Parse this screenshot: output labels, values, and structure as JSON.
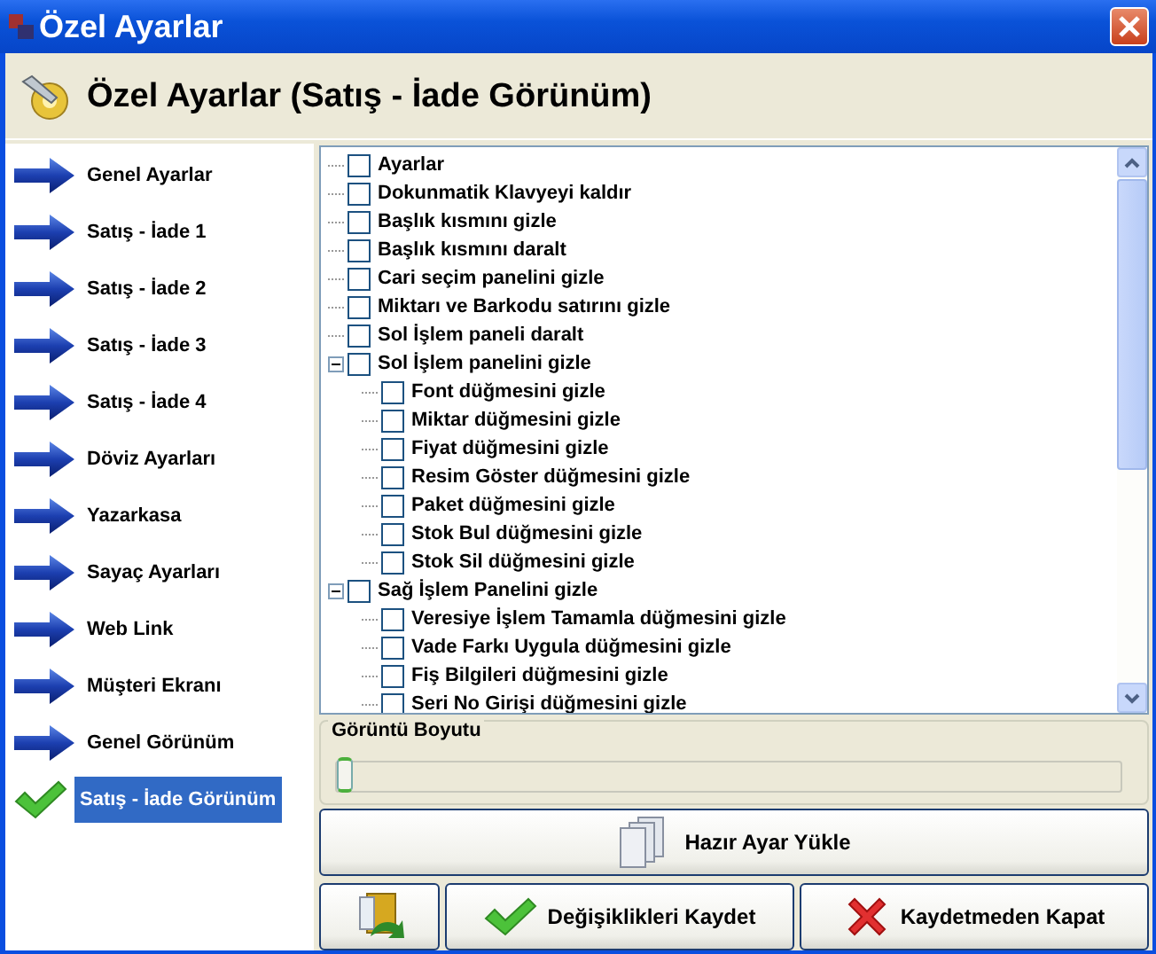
{
  "window": {
    "title": "Özel Ayarlar"
  },
  "header": {
    "title": "Özel Ayarlar (Satış - İade Görünüm)"
  },
  "sidebar": {
    "items": [
      {
        "label": "Genel Ayarlar",
        "selected": false
      },
      {
        "label": "Satış - İade 1",
        "selected": false
      },
      {
        "label": "Satış - İade 2",
        "selected": false
      },
      {
        "label": "Satış - İade 3",
        "selected": false
      },
      {
        "label": "Satış - İade 4",
        "selected": false
      },
      {
        "label": "Döviz Ayarları",
        "selected": false
      },
      {
        "label": "Yazarkasa",
        "selected": false
      },
      {
        "label": "Sayaç Ayarları",
        "selected": false
      },
      {
        "label": "Web Link",
        "selected": false
      },
      {
        "label": "Müşteri Ekranı",
        "selected": false
      },
      {
        "label": "Genel Görünüm",
        "selected": false
      },
      {
        "label": "Satış - İade Görünüm",
        "selected": true
      }
    ]
  },
  "tree": {
    "items": [
      {
        "label": "Ayarlar",
        "checked": false
      },
      {
        "label": "Dokunmatik Klavyeyi kaldır",
        "checked": false
      },
      {
        "label": "Başlık kısmını gizle",
        "checked": false
      },
      {
        "label": "Başlık kısmını daralt",
        "checked": false
      },
      {
        "label": "Cari seçim panelini gizle",
        "checked": false
      },
      {
        "label": "Miktarı ve Barkodu satırını gizle",
        "checked": false
      },
      {
        "label": "Sol İşlem paneli daralt",
        "checked": false
      },
      {
        "label": "Sol İşlem panelini gizle",
        "checked": false,
        "expanded": true,
        "children": [
          {
            "label": "Font düğmesini gizle",
            "checked": false
          },
          {
            "label": "Miktar düğmesini gizle",
            "checked": false
          },
          {
            "label": "Fiyat düğmesini gizle",
            "checked": false
          },
          {
            "label": "Resim Göster düğmesini gizle",
            "checked": false
          },
          {
            "label": "Paket düğmesini gizle",
            "checked": false
          },
          {
            "label": "Stok Bul düğmesini gizle",
            "checked": false
          },
          {
            "label": "Stok Sil düğmesini gizle",
            "checked": false
          }
        ]
      },
      {
        "label": "Sağ İşlem Panelini gizle",
        "checked": false,
        "expanded": true,
        "children": [
          {
            "label": "Veresiye İşlem Tamamla düğmesini gizle",
            "checked": false
          },
          {
            "label": "Vade Farkı Uygula düğmesini gizle",
            "checked": false
          },
          {
            "label": "Fiş Bilgileri düğmesini gizle",
            "checked": false
          },
          {
            "label": "Seri No Girişi düğmesini gizle",
            "checked": false
          }
        ]
      }
    ]
  },
  "image_size": {
    "label": "Görüntü Boyutu",
    "level": 0.0
  },
  "buttons": {
    "preset": "Hazır Ayar Yükle",
    "save": "Değişiklikleri Kaydet",
    "close": "Kaydetmeden Kapat"
  }
}
